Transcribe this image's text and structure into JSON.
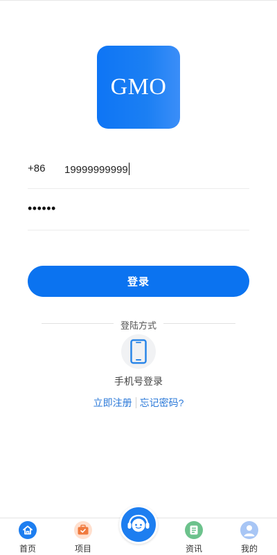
{
  "logo": {
    "text": "GMO"
  },
  "login_form": {
    "country_code": "+86",
    "phone_value": "19999999999",
    "password_value": "••••••",
    "submit_label": "登录"
  },
  "login_methods": {
    "title": "登陆方式",
    "phone_login_label": "手机号登录",
    "register_link": "立即注册",
    "forgot_link": "忘记密码?"
  },
  "tabbar": {
    "items": [
      {
        "label": "首页",
        "icon": "home-icon"
      },
      {
        "label": "项目",
        "icon": "project-icon"
      },
      {
        "label": "",
        "icon": "customer-service-icon"
      },
      {
        "label": "资讯",
        "icon": "news-icon"
      },
      {
        "label": "我的",
        "icon": "user-icon"
      }
    ]
  },
  "colors": {
    "primary": "#0b73f0",
    "link": "#2a78d8",
    "home_icon_bg": "#1d7ef0",
    "project_icon_bg": "#ffe0cf",
    "news_icon_bg": "#6cc28c",
    "user_icon_bg": "#a8c6f5"
  }
}
